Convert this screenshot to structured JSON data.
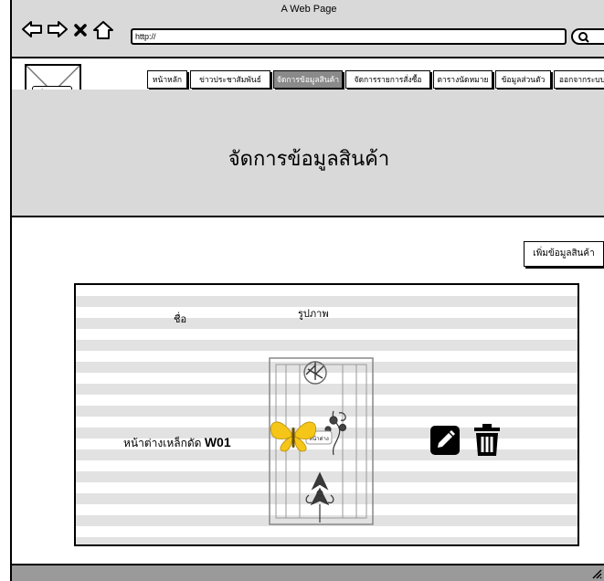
{
  "window": {
    "title": "A Web Page",
    "url": "http://"
  },
  "logo": {
    "label": "Logo"
  },
  "menu": [
    {
      "label": "หน้าหลัก",
      "active": false
    },
    {
      "label": "ข่าวประชาสัมพันธ์",
      "active": false
    },
    {
      "label": "จัดการข้อมูลสินค้า",
      "active": true
    },
    {
      "label": "จัดการรายการสั่งซื้อ",
      "active": false
    },
    {
      "label": "ตารางนัดหมาย",
      "active": false
    },
    {
      "label": "ข้อมูลส่วนตัว",
      "active": false
    },
    {
      "label": "ออกจากระบบ",
      "active": false
    }
  ],
  "header": {
    "title": "จัดการข้อมูลสินค้า"
  },
  "add_button": {
    "label": "เพิ่มข้อมูลสินค้า"
  },
  "table": {
    "columns": [
      "ชื่อ",
      "รูปภาพ"
    ],
    "rows": [
      {
        "name_prefix": "หน้าต่างเหล็กดัด",
        "name_code": "W01",
        "image_caption": "หน้าต่าง"
      }
    ]
  },
  "colors": {
    "chrome": "#d9d9d9",
    "active_menu": "#8a8a8a",
    "butterfly": "#f5c518"
  }
}
